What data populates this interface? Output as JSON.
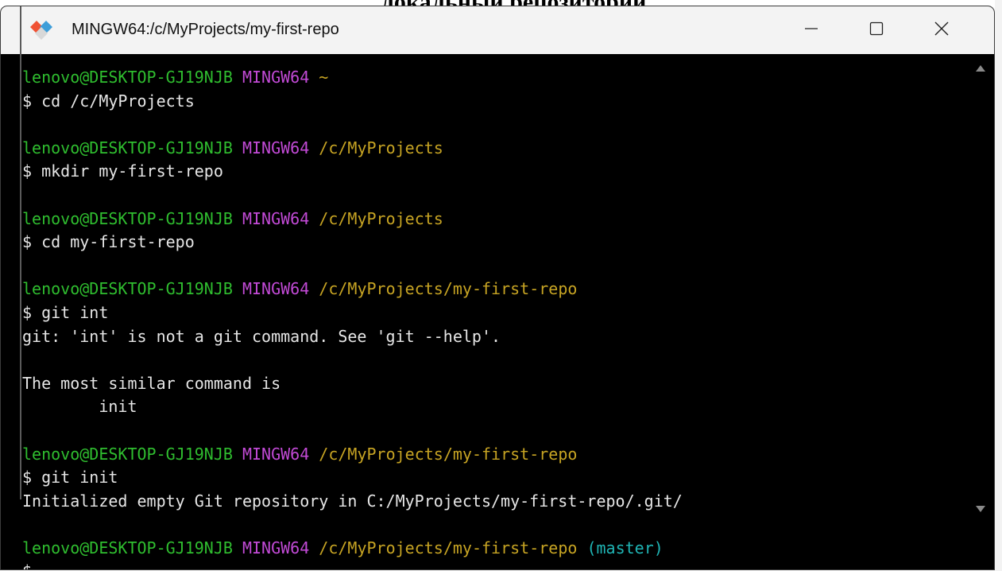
{
  "document": {
    "heading": "локальный репозиторий."
  },
  "window": {
    "title": "MINGW64:/c/MyProjects/my-first-repo",
    "icon": "git-bash-icon",
    "controls": {
      "minimize": "minimize-icon",
      "maximize": "maximize-icon",
      "close": "close-icon"
    }
  },
  "colors": {
    "user_host": "#2fbd2f",
    "mingw": "#c24ad6",
    "path": "#c7a423",
    "branch": "#1fb5b5",
    "text": "#e6e6e6",
    "background": "#000000"
  },
  "terminal": {
    "p1": {
      "user": "lenovo@DESKTOP-GJ19NJB",
      "env": "MINGW64",
      "path": "~"
    },
    "c1": "$ cd /c/MyProjects",
    "p2": {
      "user": "lenovo@DESKTOP-GJ19NJB",
      "env": "MINGW64",
      "path": "/c/MyProjects"
    },
    "c2": "$ mkdir my-first-repo",
    "p3": {
      "user": "lenovo@DESKTOP-GJ19NJB",
      "env": "MINGW64",
      "path": "/c/MyProjects"
    },
    "c3": "$ cd my-first-repo",
    "p4": {
      "user": "lenovo@DESKTOP-GJ19NJB",
      "env": "MINGW64",
      "path": "/c/MyProjects/my-first-repo"
    },
    "c4": "$ git int",
    "o4a": "git: 'int' is not a git command. See 'git --help'.",
    "o4b": "The most similar command is",
    "o4c": "        init",
    "p5": {
      "user": "lenovo@DESKTOP-GJ19NJB",
      "env": "MINGW64",
      "path": "/c/MyProjects/my-first-repo"
    },
    "c5": "$ git init",
    "o5": "Initialized empty Git repository in C:/MyProjects/my-first-repo/.git/",
    "p6": {
      "user": "lenovo@DESKTOP-GJ19NJB",
      "env": "MINGW64",
      "path": "/c/MyProjects/my-first-repo",
      "branch": "(master)"
    },
    "c6": "$"
  }
}
